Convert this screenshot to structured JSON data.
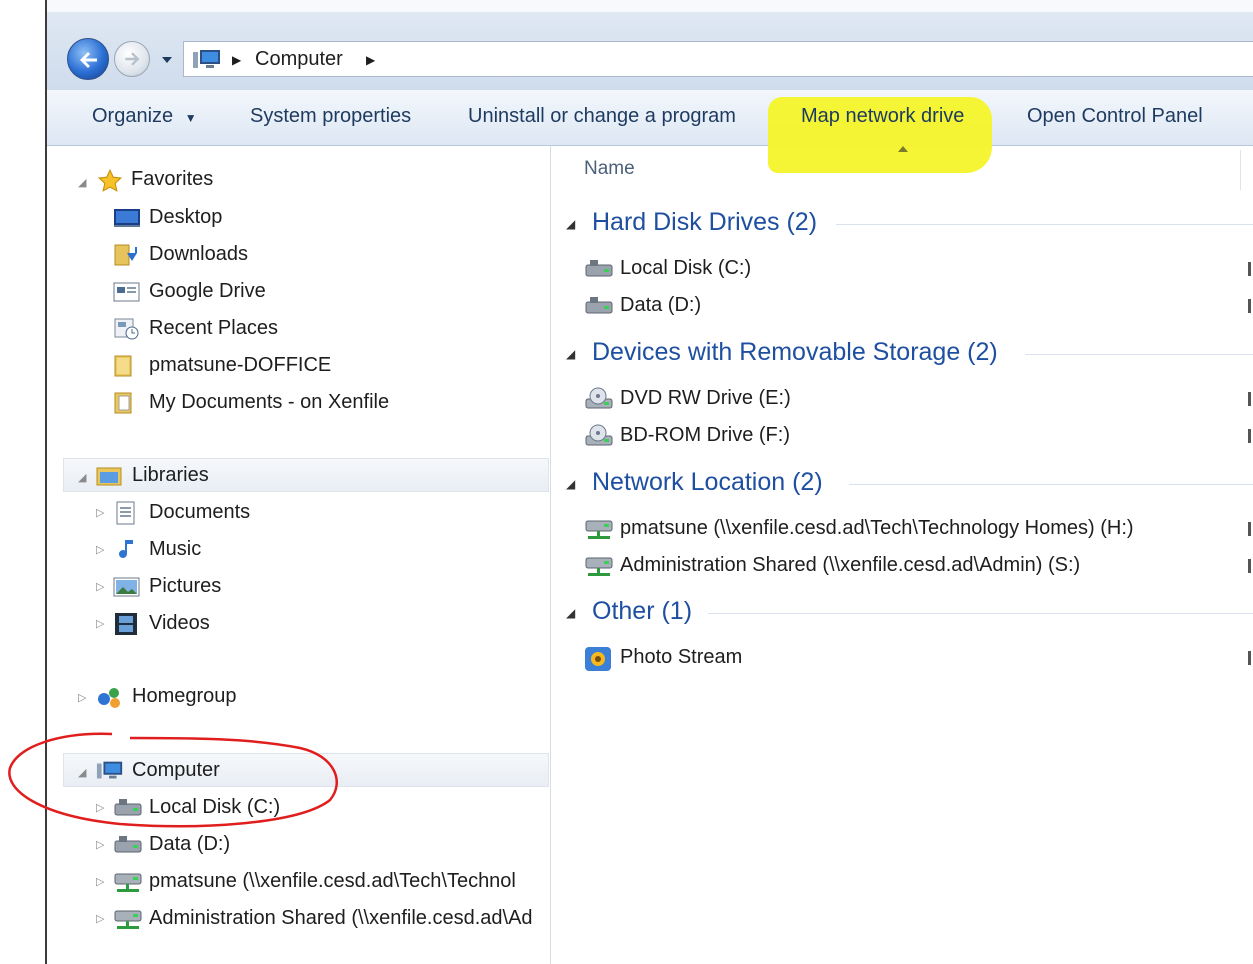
{
  "address_bar": {
    "location": "Computer"
  },
  "commands": {
    "organize": "Organize",
    "system_properties": "System properties",
    "uninstall": "Uninstall or change a program",
    "map_network_drive": "Map network drive",
    "open_control_panel": "Open Control Panel"
  },
  "nav": {
    "favorites": {
      "label": "Favorites",
      "items": [
        "Desktop",
        "Downloads",
        "Google Drive",
        "Recent Places",
        "pmatsune-DOFFICE",
        "My Documents - on Xenfile"
      ]
    },
    "libraries": {
      "label": "Libraries",
      "items": [
        "Documents",
        "Music",
        "Pictures",
        "Videos"
      ]
    },
    "homegroup": "Homegroup",
    "computer": {
      "label": "Computer",
      "items": [
        "Local Disk (C:)",
        "Data (D:)",
        "pmatsune (\\\\xenfile.cesd.ad\\Tech\\Technol",
        "Administration Shared (\\\\xenfile.cesd.ad\\Ad"
      ]
    }
  },
  "content": {
    "column_name": "Name",
    "groups": [
      {
        "title": "Hard Disk Drives (2)",
        "items": [
          "Local Disk (C:)",
          "Data (D:)"
        ]
      },
      {
        "title": "Devices with Removable Storage (2)",
        "items": [
          "DVD RW Drive (E:)",
          "BD-ROM Drive (F:)"
        ]
      },
      {
        "title": "Network Location (2)",
        "items": [
          "pmatsune (\\\\xenfile.cesd.ad\\Tech\\Technology Homes) (H:)",
          "Administration Shared (\\\\xenfile.cesd.ad\\Admin) (S:)"
        ]
      },
      {
        "title": "Other (1)",
        "items": [
          "Photo Stream"
        ]
      }
    ]
  },
  "colors": {
    "group_header": "#1e4fa0",
    "highlight": "#f4f42a",
    "annotation": "#e01e1e"
  },
  "icons": {
    "back": "back-arrow-icon",
    "forward": "forward-arrow-icon",
    "computer": "computer-icon",
    "hard_disk": "hard-disk-icon",
    "optical": "optical-drive-icon",
    "network_drive": "network-drive-icon",
    "photo_stream": "photo-stream-icon"
  }
}
